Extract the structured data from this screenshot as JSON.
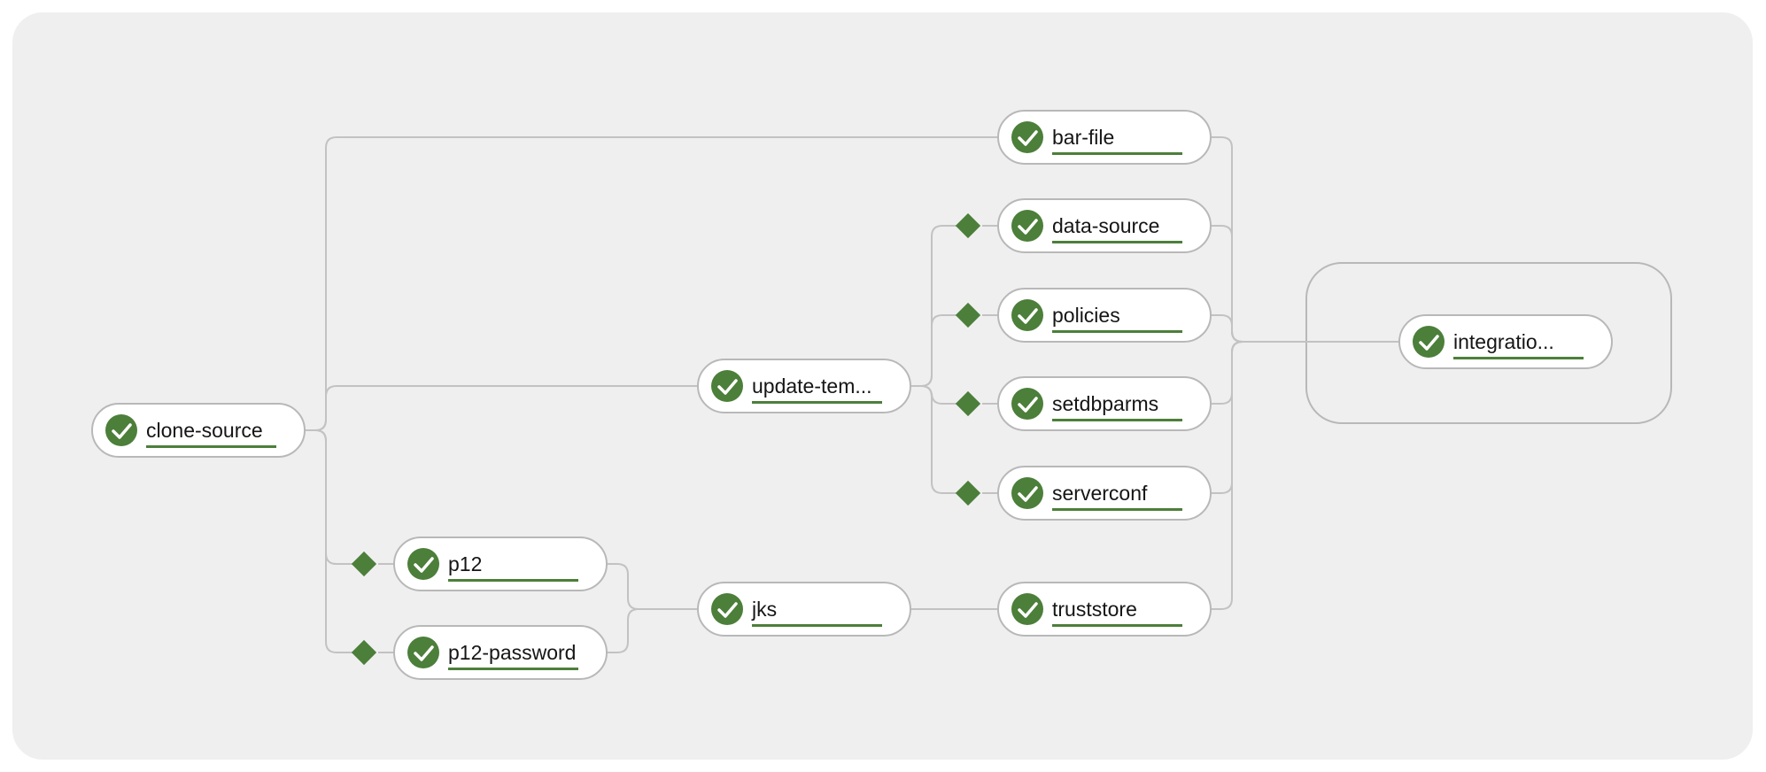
{
  "colors": {
    "background": "#efefef",
    "node_fill": "#ffffff",
    "node_stroke": "#b8b8b8",
    "edge": "#c2c2c2",
    "success": "#4c7f3a",
    "underline": "#4c7f3a",
    "text": "#151515"
  },
  "status_icon": "check-circle-icon",
  "when_icon": "diamond-icon",
  "tasks": [
    {
      "id": "clone-source",
      "label": "clone-source",
      "status": "succeeded",
      "when": false
    },
    {
      "id": "bar-file",
      "label": "bar-file",
      "status": "succeeded",
      "when": false
    },
    {
      "id": "update-templates",
      "label": "update-tem...",
      "status": "succeeded",
      "when": false
    },
    {
      "id": "data-source",
      "label": "data-source",
      "status": "succeeded",
      "when": true
    },
    {
      "id": "policies",
      "label": "policies",
      "status": "succeeded",
      "when": true
    },
    {
      "id": "setdbparms",
      "label": "setdbparms",
      "status": "succeeded",
      "when": true
    },
    {
      "id": "serverconf",
      "label": "serverconf",
      "status": "succeeded",
      "when": true
    },
    {
      "id": "p12",
      "label": "p12",
      "status": "succeeded",
      "when": true
    },
    {
      "id": "p12-password",
      "label": "p12-password",
      "status": "succeeded",
      "when": true
    },
    {
      "id": "jks",
      "label": "jks",
      "status": "succeeded",
      "when": false
    },
    {
      "id": "truststore",
      "label": "truststore",
      "status": "succeeded",
      "when": false
    },
    {
      "id": "integration",
      "label": "integratio...",
      "status": "succeeded",
      "when": false,
      "group": "finally"
    }
  ],
  "edges": [
    [
      "clone-source",
      "bar-file"
    ],
    [
      "clone-source",
      "update-templates"
    ],
    [
      "clone-source",
      "p12"
    ],
    [
      "clone-source",
      "p12-password"
    ],
    [
      "update-templates",
      "data-source"
    ],
    [
      "update-templates",
      "policies"
    ],
    [
      "update-templates",
      "setdbparms"
    ],
    [
      "update-templates",
      "serverconf"
    ],
    [
      "p12",
      "jks"
    ],
    [
      "p12-password",
      "jks"
    ],
    [
      "jks",
      "truststore"
    ],
    [
      "bar-file",
      "integration"
    ],
    [
      "data-source",
      "integration"
    ],
    [
      "policies",
      "integration"
    ],
    [
      "setdbparms",
      "integration"
    ],
    [
      "serverconf",
      "integration"
    ],
    [
      "truststore",
      "integration"
    ]
  ]
}
